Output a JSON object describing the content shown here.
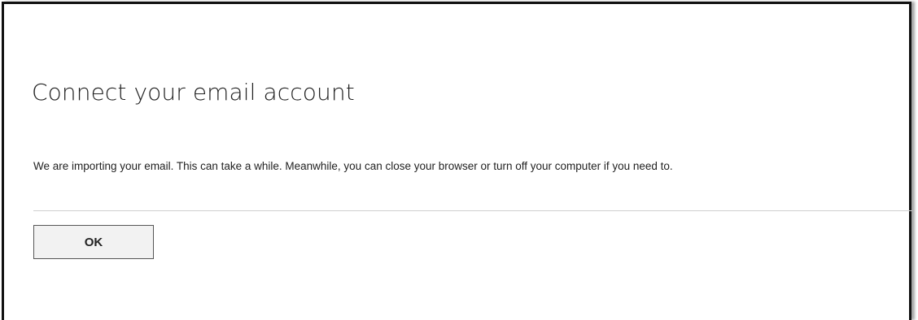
{
  "dialog": {
    "title": "Connect your email account",
    "message": "We are importing your email. This can take a while. Meanwhile, you can close your browser or turn off your computer if you need to.",
    "ok_label": "OK"
  },
  "colors": {
    "frame_border": "#111111",
    "text": "#222222",
    "divider": "#cfcfcf",
    "button_bg": "#f2f2f2",
    "button_border": "#555555"
  }
}
